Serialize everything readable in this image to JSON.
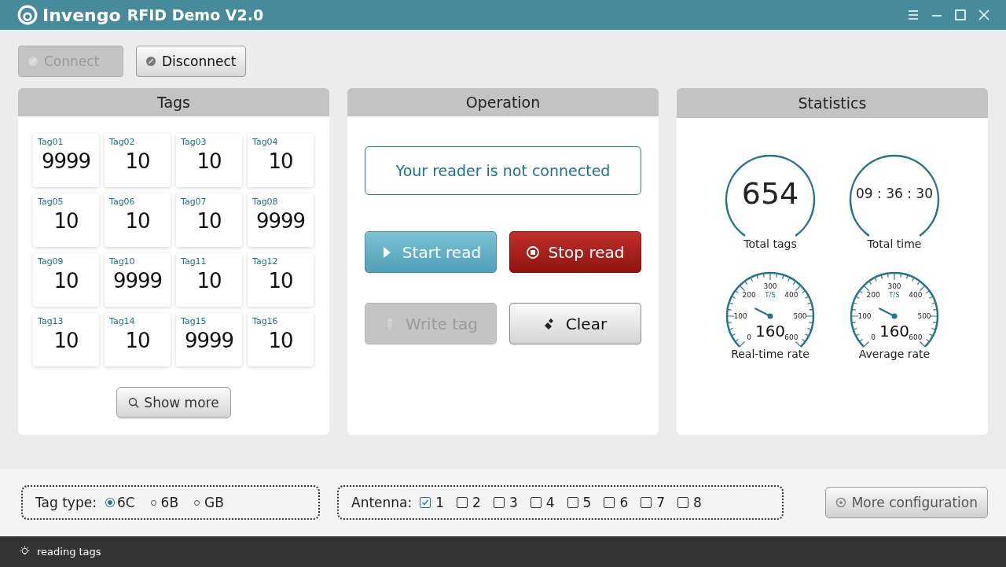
{
  "window": {
    "title_brand": "Invengo",
    "title_rest": "RFID Demo V2.0"
  },
  "toolbar": [
    {
      "label": "Connect",
      "disabled": true
    },
    {
      "label": "Disconnect",
      "disabled": false
    }
  ],
  "tags_panel": {
    "title": "Tags",
    "tags": [
      {
        "name": "Tag01",
        "count": "9999"
      },
      {
        "name": "Tag02",
        "count": "10"
      },
      {
        "name": "Tag03",
        "count": "10"
      },
      {
        "name": "Tag04",
        "count": "10"
      },
      {
        "name": "Tag05",
        "count": "10"
      },
      {
        "name": "Tag06",
        "count": "10"
      },
      {
        "name": "Tag07",
        "count": "10"
      },
      {
        "name": "Tag08",
        "count": "9999"
      },
      {
        "name": "Tag09",
        "count": "10"
      },
      {
        "name": "Tag10",
        "count": "9999"
      },
      {
        "name": "Tag11",
        "count": "10"
      },
      {
        "name": "Tag12",
        "count": "10"
      },
      {
        "name": "Tag13",
        "count": "10"
      },
      {
        "name": "Tag14",
        "count": "10"
      },
      {
        "name": "Tag15",
        "count": "9999"
      },
      {
        "name": "Tag16",
        "count": "10"
      }
    ],
    "show_more": "Show more"
  },
  "operation_panel": {
    "title": "Operation",
    "message": "Your reader is not connected",
    "buttons": [
      {
        "label": "Start read",
        "kind": "start",
        "disabled": false
      },
      {
        "label": "Stop read",
        "kind": "stop",
        "disabled": false
      },
      {
        "label": "Write  tag",
        "kind": "write",
        "disabled": true
      },
      {
        "label": "Clear",
        "kind": "clear",
        "disabled": false
      }
    ]
  },
  "statistics_panel": {
    "title": "Statistics",
    "counters": [
      {
        "value": "654",
        "label": "Total tags",
        "kind": "big"
      },
      {
        "value": "09 : 36 : 30",
        "label": "Total time",
        "kind": "time"
      }
    ],
    "gauges": [
      {
        "label": "Real-time rate",
        "value": "160",
        "unit": "T/S",
        "scale": [
          "0",
          "100",
          "200",
          "300",
          "400",
          "500",
          "600"
        ]
      },
      {
        "label": "Average rate",
        "value": "160",
        "unit": "T/S",
        "scale": [
          "0",
          "100",
          "200",
          "300",
          "400",
          "500",
          "600"
        ]
      }
    ]
  },
  "tag_type": {
    "label": "Tag type:",
    "options": [
      {
        "label": "6C",
        "selected": true
      },
      {
        "label": "6B",
        "selected": false
      },
      {
        "label": "GB",
        "selected": false
      }
    ]
  },
  "antenna": {
    "label": "Antenna:",
    "options": [
      {
        "label": "1",
        "checked": true
      },
      {
        "label": "2",
        "checked": false
      },
      {
        "label": "3",
        "checked": false
      },
      {
        "label": "4",
        "checked": false
      },
      {
        "label": "5",
        "checked": false
      },
      {
        "label": "6",
        "checked": false
      },
      {
        "label": "7",
        "checked": false
      },
      {
        "label": "8",
        "checked": false
      }
    ]
  },
  "more_configuration": "More configuration",
  "status_bar": {
    "text": "reading tags"
  }
}
